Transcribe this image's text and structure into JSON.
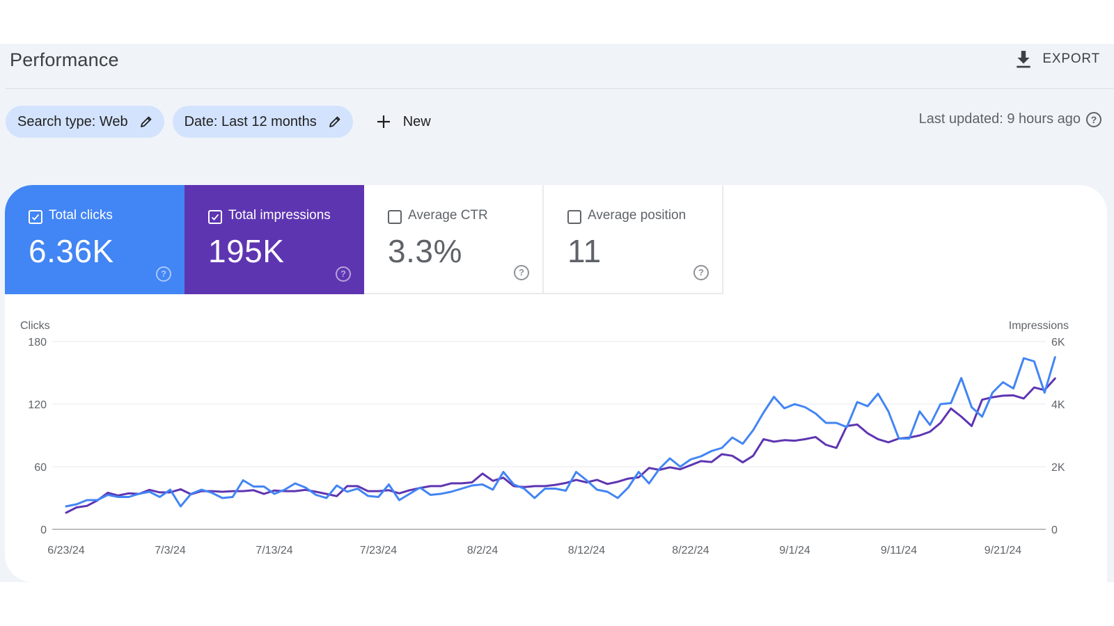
{
  "header": {
    "title": "Performance",
    "export_label": "EXPORT",
    "export_icon": "download-icon"
  },
  "filters": {
    "chips": [
      {
        "label": "Search type: Web",
        "icon": "edit-pencil-icon"
      },
      {
        "label": "Date: Last 12 months",
        "icon": "edit-pencil-icon"
      }
    ],
    "new_label": "New",
    "new_icon": "plus-icon",
    "last_updated": "Last updated: 9 hours ago",
    "last_updated_icon": "help-icon"
  },
  "metrics": [
    {
      "label": "Total clicks",
      "value": "6.36K",
      "checked": true,
      "color": "#4285f4"
    },
    {
      "label": "Total impressions",
      "value": "195K",
      "checked": true,
      "color": "#5e35b1"
    },
    {
      "label": "Average CTR",
      "value": "3.3%",
      "checked": false,
      "color": "#ffffff"
    },
    {
      "label": "Average position",
      "value": "11",
      "checked": false,
      "color": "#ffffff"
    }
  ],
  "colors": {
    "clicks": "#4285f4",
    "impressions": "#5e35b1",
    "page_bg": "#f0f4f9",
    "chip_bg": "#d3e3fd"
  },
  "chart_data": {
    "type": "line",
    "title": "",
    "xlabel": "",
    "ylabel": "Clicks",
    "ylabel_right": "Impressions",
    "ylim": [
      0,
      180
    ],
    "ylim_right": [
      0,
      6000
    ],
    "yticks": [
      "0",
      "60",
      "120",
      "180"
    ],
    "yticks_right": [
      "0",
      "2K",
      "4K",
      "6K"
    ],
    "grid": true,
    "start_date": "6/23/24",
    "x_tick_labels": [
      "6/23/24",
      "7/3/24",
      "7/13/24",
      "7/23/24",
      "8/2/24",
      "8/12/24",
      "8/22/24",
      "9/1/24",
      "9/11/24",
      "9/21/24"
    ],
    "x_tick_day_index": [
      0,
      10,
      20,
      30,
      40,
      50,
      60,
      70,
      80,
      90
    ],
    "series": [
      {
        "name": "Clicks",
        "axis": "left",
        "color": "#4285f4",
        "values": [
          22,
          24,
          28,
          28,
          33,
          31,
          31,
          34,
          36,
          31,
          38,
          22,
          34,
          38,
          35,
          30,
          31,
          47,
          41,
          41,
          34,
          38,
          44,
          40,
          33,
          30,
          42,
          36,
          39,
          32,
          31,
          43,
          28,
          34,
          40,
          33,
          34,
          36,
          39,
          42,
          43,
          38,
          55,
          43,
          39,
          30,
          39,
          39,
          37,
          55,
          47,
          38,
          36,
          30,
          40,
          55,
          44,
          58,
          68,
          60,
          67,
          70,
          75,
          78,
          88,
          82,
          95,
          112,
          127,
          116,
          120,
          117,
          111,
          102,
          102,
          98,
          122,
          118,
          130,
          113,
          87,
          87,
          113,
          100,
          120,
          121,
          145,
          117,
          108,
          131,
          141,
          135,
          164,
          161,
          131,
          165
        ]
      },
      {
        "name": "Impressions",
        "axis": "right",
        "color": "#5e35b1",
        "values": [
          530,
          700,
          750,
          920,
          1170,
          1080,
          1150,
          1130,
          1260,
          1180,
          1180,
          1280,
          1120,
          1220,
          1220,
          1200,
          1220,
          1220,
          1250,
          1130,
          1240,
          1220,
          1220,
          1260,
          1200,
          1130,
          1060,
          1380,
          1380,
          1220,
          1220,
          1250,
          1150,
          1250,
          1320,
          1380,
          1380,
          1470,
          1470,
          1500,
          1780,
          1550,
          1650,
          1380,
          1350,
          1380,
          1380,
          1420,
          1480,
          1580,
          1500,
          1580,
          1450,
          1520,
          1620,
          1660,
          1960,
          1900,
          1980,
          1920,
          2050,
          2180,
          2150,
          2400,
          2350,
          2140,
          2350,
          2880,
          2800,
          2850,
          2830,
          2880,
          2950,
          2700,
          2600,
          3300,
          3350,
          3070,
          2880,
          2780,
          2900,
          2930,
          3000,
          3120,
          3400,
          3860,
          3600,
          3300,
          4140,
          4220,
          4270,
          4280,
          4180,
          4530,
          4450,
          4820
        ]
      }
    ]
  }
}
